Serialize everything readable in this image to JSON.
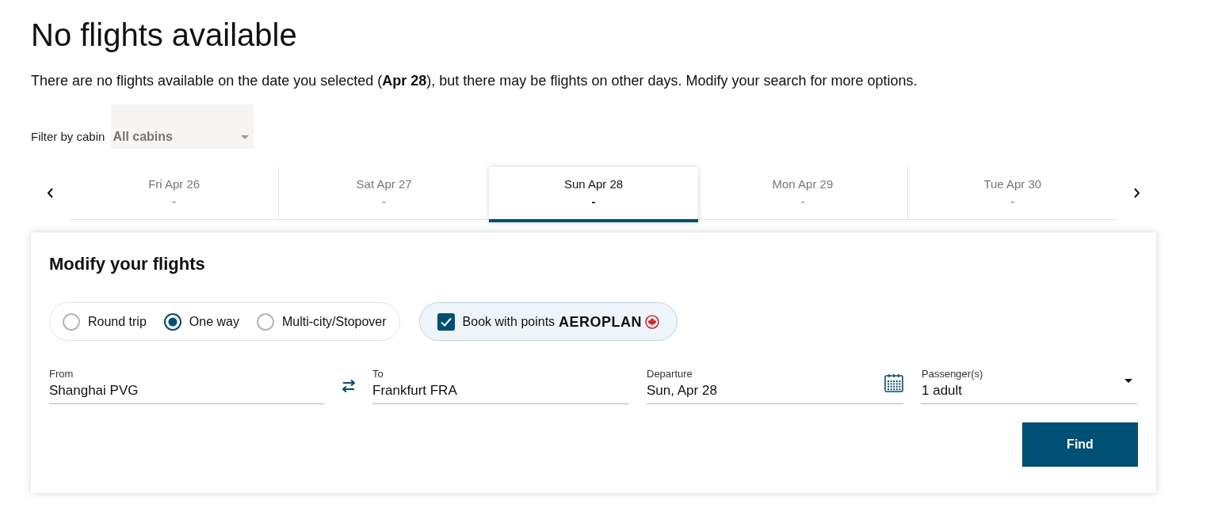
{
  "heading": "No flights available",
  "message": "There are no flights available on the date you selected (**Apr 28**), but there may be flights on other days. Modify your search for more options.",
  "cabin_filter": {
    "label": "Filter by cabin",
    "value": "All cabins"
  },
  "date_tabs": [
    {
      "date": "Fri Apr 26",
      "price": "-",
      "selected": false
    },
    {
      "date": "Sat Apr 27",
      "price": "-",
      "selected": false
    },
    {
      "date": "Sun Apr 28",
      "price": "-",
      "selected": true
    },
    {
      "date": "Mon Apr 29",
      "price": "-",
      "selected": false
    },
    {
      "date": "Tue Apr 30",
      "price": "-",
      "selected": false
    }
  ],
  "modify_panel": {
    "title": "Modify your flights",
    "trip_types": [
      {
        "label": "Round trip",
        "selected": false
      },
      {
        "label": "One way",
        "selected": true
      },
      {
        "label": "Multi-city/Stopover",
        "selected": false
      }
    ],
    "book_with_points": {
      "label": "Book with points",
      "brand": "AEROPLAN",
      "checked": true
    },
    "from": {
      "label": "From",
      "value": "Shanghai PVG"
    },
    "to": {
      "label": "To",
      "value": "Frankfurt FRA"
    },
    "departure": {
      "label": "Departure",
      "value": "Sun, Apr 28"
    },
    "passengers": {
      "label": "Passenger(s)",
      "value": "1 adult"
    },
    "find_button": "Find"
  }
}
